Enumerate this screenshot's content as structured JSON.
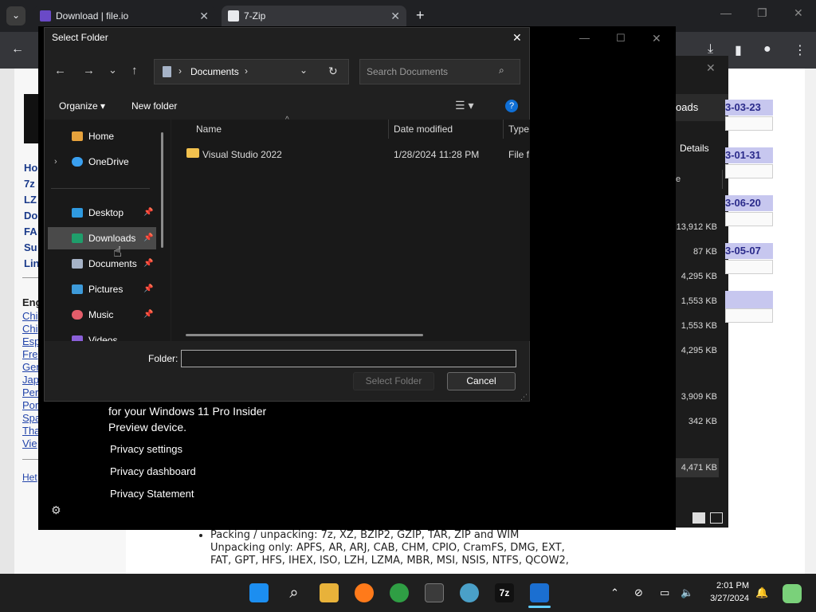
{
  "browser": {
    "tabs": [
      {
        "label": "Download | file.io"
      },
      {
        "label": "7-Zip"
      }
    ],
    "new_tab": "+",
    "dropdown": "⌄"
  },
  "webpage": {
    "left_nav": [
      "Ho",
      "7z",
      "LZ",
      "Do",
      "FA",
      "Su",
      "Lin"
    ],
    "lang_header": "Eng",
    "languages": [
      "Chi",
      "Chi",
      "Esp",
      "Fre",
      "Ger",
      "Jap",
      "Per",
      "Por",
      "Spa",
      "Tha",
      "Vie"
    ],
    "help": "Het",
    "bullets": [
      "Packing / unpacking: 7z, XZ, BZIP2, GZIP, TAR, ZIP and WIM",
      "Unpacking only: APFS, AR, ARJ, CAB, CHM, CPIO, CramFS, DMG, EXT, FAT, GPT, HFS, IHEX, ISO, LZH, LZMA, MBR, MSI, NSIS, NTFS, QCOW2, RAR, RPM, SquashFS, UDF, UEFI, VDI, VHD, VHDX, VMDK, XAR and Z."
    ]
  },
  "zip_window": {
    "tab_downloads": "oads",
    "tab_details": "Details",
    "col_partial": "e",
    "dates": [
      "3-03-23",
      "3-01-31",
      "3-06-20",
      "3-05-07"
    ],
    "sizes": [
      "13,912 KB",
      "87 KB",
      "4,295 KB",
      "1,553 KB",
      "1,553 KB",
      "4,295 KB",
      "3,909 KB",
      "342 KB",
      "4,471 KB"
    ]
  },
  "download_window": {
    "privacy_text_1": "for your Windows 11 Pro Insider",
    "privacy_text_2": "Preview device.",
    "links": [
      "Privacy settings",
      "Privacy dashboard",
      "Privacy Statement"
    ]
  },
  "dialog": {
    "title": "Select Folder",
    "address": "Documents",
    "search_placeholder": "Search Documents",
    "organize": "Organize",
    "new_folder": "New folder",
    "nav_items": [
      {
        "label": "Home"
      },
      {
        "label": "OneDrive"
      },
      {
        "label": "Desktop"
      },
      {
        "label": "Downloads"
      },
      {
        "label": "Documents"
      },
      {
        "label": "Pictures"
      },
      {
        "label": "Music"
      },
      {
        "label": "Videos"
      }
    ],
    "columns": {
      "name": "Name",
      "date": "Date modified",
      "type": "Type"
    },
    "rows": [
      {
        "name": "Visual Studio 2022",
        "date": "1/28/2024 11:28 PM",
        "type": "File fo"
      }
    ],
    "folder_label": "Folder:",
    "folder_value": "",
    "select_button": "Select Folder",
    "cancel_button": "Cancel"
  },
  "taskbar": {
    "time": "2:01 PM",
    "date": "3/27/2024",
    "app_7z": "7z"
  },
  "colors": {
    "accent": "#0078d4",
    "dialog_bg": "#202020",
    "selected_nav": "#4a4a4a"
  }
}
